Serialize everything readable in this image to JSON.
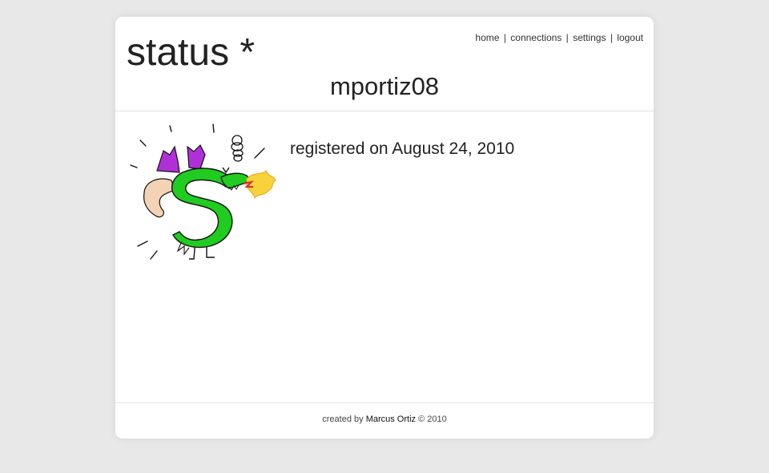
{
  "header": {
    "title": "status *",
    "username": "mportiz08"
  },
  "nav": {
    "items": [
      {
        "label": "home"
      },
      {
        "label": "connections"
      },
      {
        "label": "settings"
      },
      {
        "label": "logout"
      }
    ],
    "separator": "|"
  },
  "profile": {
    "avatar_icon": "dragon-drawing-icon",
    "registered_text": "registered on August 24, 2010"
  },
  "footer": {
    "prefix": "created by ",
    "author": "Marcus Ortiz",
    "suffix": " © 2010"
  },
  "colors": {
    "background": "#e8e8e8",
    "card": "#ffffff",
    "text": "#222222",
    "divider": "#e2e2e2",
    "dragon_body": "#1fcc1f",
    "dragon_wings": "#b030d8",
    "fire": "#f7d23a"
  }
}
